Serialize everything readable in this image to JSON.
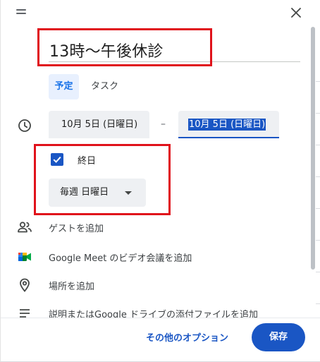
{
  "event": {
    "title": "13時〜午後休診"
  },
  "tabs": [
    {
      "label": "予定",
      "active": true
    },
    {
      "label": "タスク",
      "active": false
    }
  ],
  "datetime": {
    "start_date": "10月 5日 (日曜日)",
    "separator": "–",
    "end_date": "10月 5日 (日曜日)"
  },
  "all_day": {
    "label": "終日",
    "checked": true
  },
  "recurrence": {
    "selected": "毎週 日曜日"
  },
  "options": {
    "guests": "ゲストを追加",
    "meet": "Google Meet のビデオ会議を追加",
    "location": "場所を追加",
    "description": "説明またはGoogle ドライブの添付ファイルを追加"
  },
  "footer": {
    "more_options": "その他のオプション",
    "save": "保存"
  },
  "colors": {
    "accent": "#1a56c4",
    "active_tab_bg": "#e8f0fe",
    "field_bg": "#eef0f3",
    "highlight_border": "#e0121b",
    "meet_green": "#00832d",
    "meet_blue": "#2684fc",
    "meet_yellow": "#ffba00",
    "meet_red": "#ea4335"
  },
  "icons": {
    "drag": "drag-handle-icon",
    "close": "close-icon",
    "clock": "clock-icon",
    "check": "check-icon",
    "dropdown": "chevron-down-icon",
    "guests": "people-icon",
    "meet": "google-meet-icon",
    "location": "location-pin-icon",
    "description": "notes-icon"
  }
}
